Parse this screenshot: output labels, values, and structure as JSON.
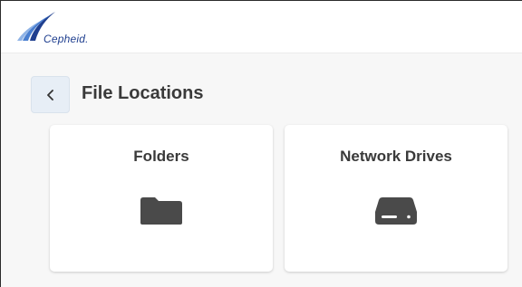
{
  "header": {
    "logo_text": "Cepheid.",
    "logo_icon": "cepheid-logo-swoosh",
    "brand_color": "#1f3f8f"
  },
  "navigation": {
    "back_icon": "chevron-left-icon"
  },
  "page": {
    "title": "File Locations"
  },
  "cards": [
    {
      "label": "Folders",
      "icon": "folder-icon"
    },
    {
      "label": "Network Drives",
      "icon": "hard-drive-icon"
    }
  ],
  "colors": {
    "background": "#f7f7f7",
    "card": "#ffffff",
    "text": "#3a3a3a",
    "icon": "#4a4a4a",
    "back_button": "#e7eef6"
  }
}
